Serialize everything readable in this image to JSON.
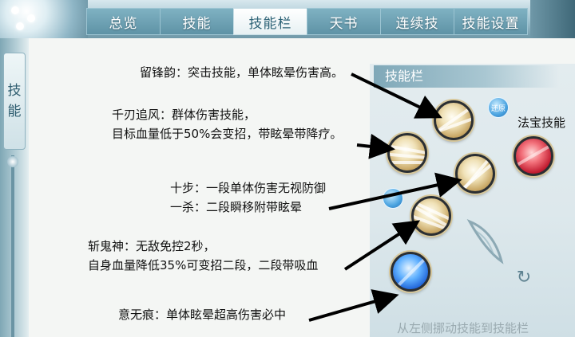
{
  "tabs": [
    {
      "label": "总览",
      "active": false
    },
    {
      "label": "技能",
      "active": false
    },
    {
      "label": "技能栏",
      "active": true
    },
    {
      "label": "天书",
      "active": false
    },
    {
      "label": "连续技",
      "active": false
    },
    {
      "label": "技能设置",
      "active": false
    }
  ],
  "side_tab": {
    "chars": [
      "技",
      "能"
    ]
  },
  "notes": {
    "liufengyun": "留锋韵：突击技能，单体眩晕伤害高。",
    "qianren_1": "千刃追风：群体伤害技能，",
    "qianren_2": "目标血量低于50%会变招，带眩晕带降疗。",
    "shibu_1": "十步：一段单体伤害无视防御",
    "shibu_2": "一杀：二段瞬移附带眩晕",
    "zhanguishen_1": "斩鬼神：无敌免控2秒，",
    "zhanguishen_2": "自身血量降低35%可变招二段，二段带吸血",
    "yiwuhen": "意无痕：单体眩晕超高伤害必中"
  },
  "skill_bar": {
    "title": "技能栏",
    "restore_button": "还原",
    "fabao_label": "法宝技能",
    "footer": "从左侧挪动技能到技能栏"
  },
  "icons": {
    "refresh": "refresh-icon",
    "weapon": "weapon-slot-icon",
    "arrow": "pointer-arrow"
  },
  "colors": {
    "tab_active_text": "#2d6276",
    "tab_bg": "#6fa3b5",
    "annotation_text": "#111111",
    "skill_gold": "#c9a866",
    "skill_blue": "#1f63d8",
    "skill_red": "#c21e32"
  }
}
